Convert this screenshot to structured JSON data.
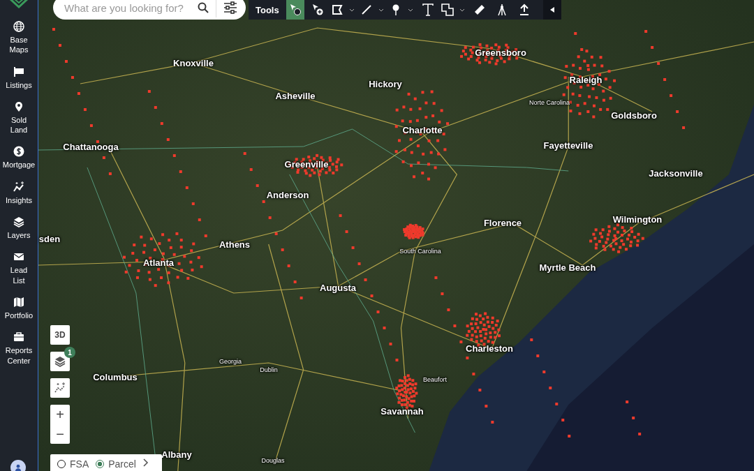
{
  "sidebar": {
    "items": [
      {
        "label": "Base Maps"
      },
      {
        "label": "Listings"
      },
      {
        "label": "Sold Land"
      },
      {
        "label": "Mortgage"
      },
      {
        "label": "Insights"
      },
      {
        "label": "Layers"
      },
      {
        "label": "Lead List"
      },
      {
        "label": "Portfolio"
      },
      {
        "label": "Reports Center"
      }
    ]
  },
  "search": {
    "placeholder": "What are you looking for?"
  },
  "toolbar": {
    "title": "Tools",
    "tools": [
      {
        "selected": true,
        "dropdown": false
      },
      {
        "selected": false,
        "dropdown": false
      },
      {
        "selected": false,
        "dropdown": true
      },
      {
        "selected": false,
        "dropdown": true
      },
      {
        "selected": false,
        "dropdown": true
      },
      {
        "selected": false,
        "dropdown": false
      },
      {
        "selected": false,
        "dropdown": true
      },
      {
        "selected": false,
        "dropdown": false
      },
      {
        "selected": false,
        "dropdown": false
      },
      {
        "selected": false,
        "dropdown": false
      }
    ]
  },
  "map": {
    "labels": [
      {
        "text": "Knoxville",
        "kind": "city"
      },
      {
        "text": "Greensboro",
        "kind": "city"
      },
      {
        "text": "Raleigh",
        "kind": "city"
      },
      {
        "text": "Asheville",
        "kind": "city"
      },
      {
        "text": "Hickory",
        "kind": "city"
      },
      {
        "text": "Norte Carolina",
        "kind": "region"
      },
      {
        "text": "Goldsboro",
        "kind": "city"
      },
      {
        "text": "Charlotte",
        "kind": "city"
      },
      {
        "text": "Chattanooga",
        "kind": "city"
      },
      {
        "text": "Fayetteville",
        "kind": "city"
      },
      {
        "text": "Greenville",
        "kind": "city"
      },
      {
        "text": "Jacksonville",
        "kind": "city"
      },
      {
        "text": "Anderson",
        "kind": "city"
      },
      {
        "text": "Florence",
        "kind": "city"
      },
      {
        "text": "Wilmington",
        "kind": "city"
      },
      {
        "text": "sden",
        "kind": "city"
      },
      {
        "text": "Athens",
        "kind": "city"
      },
      {
        "text": "South Carolina",
        "kind": "region"
      },
      {
        "text": "Atlanta",
        "kind": "city"
      },
      {
        "text": "Myrtle Beach",
        "kind": "city"
      },
      {
        "text": "Augusta",
        "kind": "city"
      },
      {
        "text": "Charleston",
        "kind": "city"
      },
      {
        "text": "Georgia",
        "kind": "region"
      },
      {
        "text": "Beaufort",
        "kind": "region"
      },
      {
        "text": "Dublin",
        "kind": "region"
      },
      {
        "text": "Columbus",
        "kind": "city"
      },
      {
        "text": "Savannah",
        "kind": "city"
      },
      {
        "text": "Albany",
        "kind": "city"
      },
      {
        "text": "Douglas",
        "kind": "region"
      }
    ]
  },
  "controls": {
    "three_d": "3D",
    "layers_badge": "1",
    "zoom_in": "+",
    "zoom_out": "−"
  },
  "parcel_toggle": {
    "options": [
      {
        "label": "FSA",
        "selected": false
      },
      {
        "label": "Parcel",
        "selected": true
      }
    ]
  }
}
